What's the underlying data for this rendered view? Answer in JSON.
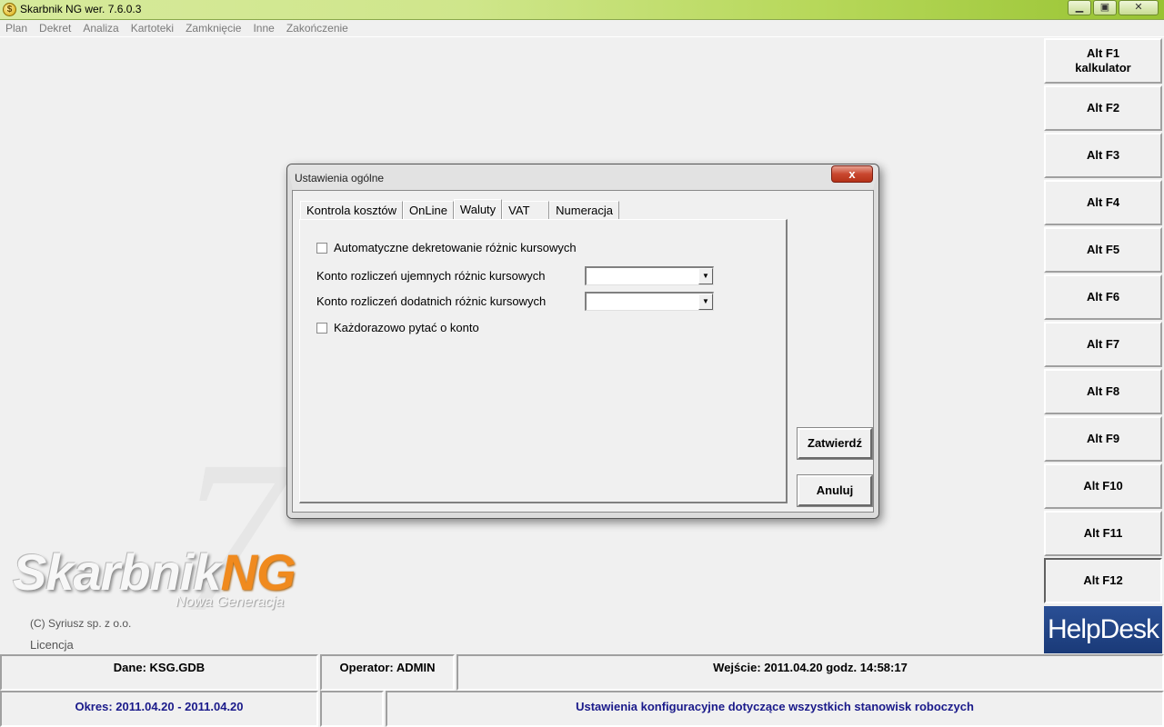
{
  "window": {
    "title": "Skarbnik NG wer. 7.6.0.3",
    "minimize_glyph": "▁",
    "maximize_glyph": "▣",
    "close_glyph": "✕"
  },
  "menu": [
    "Plan",
    "Dekret",
    "Analiza",
    "Kartoteki",
    "Zamknięcie",
    "Inne",
    "Zakończenie"
  ],
  "fkeys": [
    {
      "line1": "Alt F1",
      "line2": "kalkulator"
    },
    {
      "line1": "Alt F2",
      "line2": ""
    },
    {
      "line1": "Alt F3",
      "line2": ""
    },
    {
      "line1": "Alt F4",
      "line2": ""
    },
    {
      "line1": "Alt F5",
      "line2": ""
    },
    {
      "line1": "Alt F6",
      "line2": ""
    },
    {
      "line1": "Alt F7",
      "line2": ""
    },
    {
      "line1": "Alt F8",
      "line2": ""
    },
    {
      "line1": "Alt F9",
      "line2": ""
    },
    {
      "line1": "Alt F10",
      "line2": ""
    },
    {
      "line1": "Alt F11",
      "line2": ""
    },
    {
      "line1": "Alt F12",
      "line2": ""
    }
  ],
  "helpdesk": "HelpDesk",
  "branding": {
    "seven": "7",
    "logo_main": "Skarbnik",
    "logo_ng": "NG",
    "logo_sub": "Nowa Generacja",
    "copyright": "(C) Syriusz sp. z o.o.",
    "licence": "Licencja"
  },
  "status": {
    "dane": "Dane: KSG.GDB",
    "operator": "Operator: ADMIN",
    "wejscie": "Wejście: 2011.04.20 godz. 14:58:17",
    "okres": "Okres: 2011.04.20 - 2011.04.20",
    "empty": "",
    "description": "Ustawienia konfiguracyjne dotyczące wszystkich stanowisk roboczych"
  },
  "dialog": {
    "title": "Ustawienia ogólne",
    "close_glyph": "x",
    "tabs": [
      "Kontrola kosztów",
      "OnLine",
      "Waluty",
      "VAT",
      "Numeracja"
    ],
    "active_tab": "Waluty",
    "auto_checkbox": "Automatyczne dekretowanie różnic kursowych",
    "negative_label": "Konto rozliczeń ujemnych różnic kursowych",
    "negative_value": "",
    "positive_label": "Konto rozliczeń dodatnich różnic kursowych",
    "positive_value": "",
    "ask_checkbox": "Każdorazowo pytać o konto",
    "combo_arrow": "▼",
    "confirm": "Zatwierdź",
    "cancel": "Anuluj"
  },
  "colors": {
    "titlebar": "#b7d85a",
    "helpdesk": "#1a3a78",
    "status_blue": "#1a1a8a",
    "logo_orange": "#f08a1e"
  }
}
